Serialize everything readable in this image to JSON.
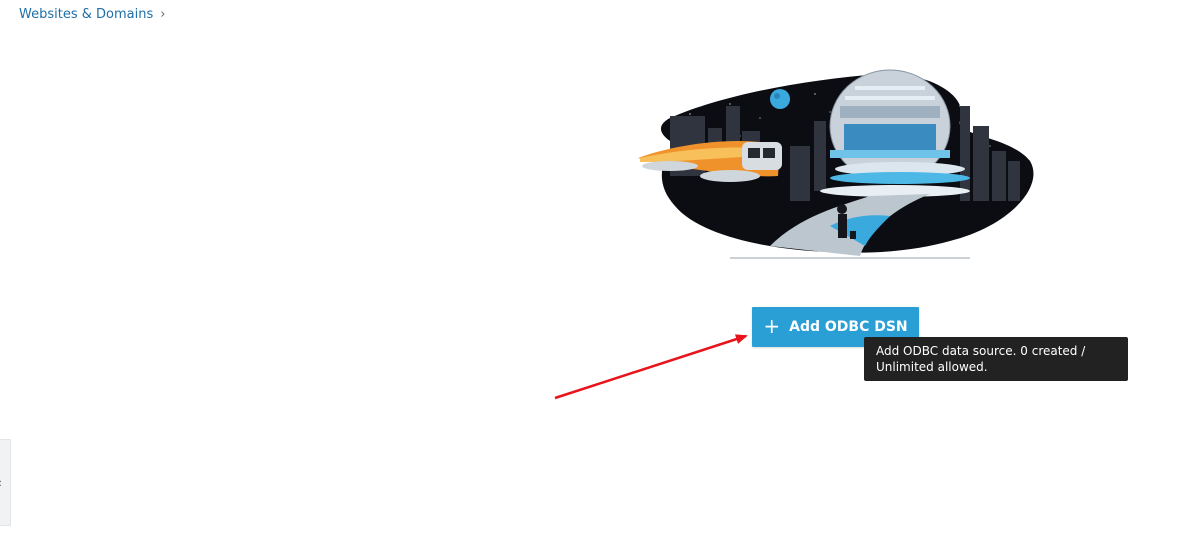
{
  "breadcrumb": {
    "item": "Websites & Domains",
    "separator_icon": "chevron-right-icon"
  },
  "main": {
    "add_button_label": "Add ODBC DSN",
    "add_button_icon": "plus-icon",
    "tooltip": "Add ODBC data source. 0 created / Unlimited allowed."
  },
  "side_tab": {
    "icon": "chevron-left-icon"
  },
  "colors": {
    "accent": "#2a9fd6",
    "link": "#1f6fa8",
    "tooltip_bg": "#222222",
    "annotation_arrow": "#e8141c"
  }
}
